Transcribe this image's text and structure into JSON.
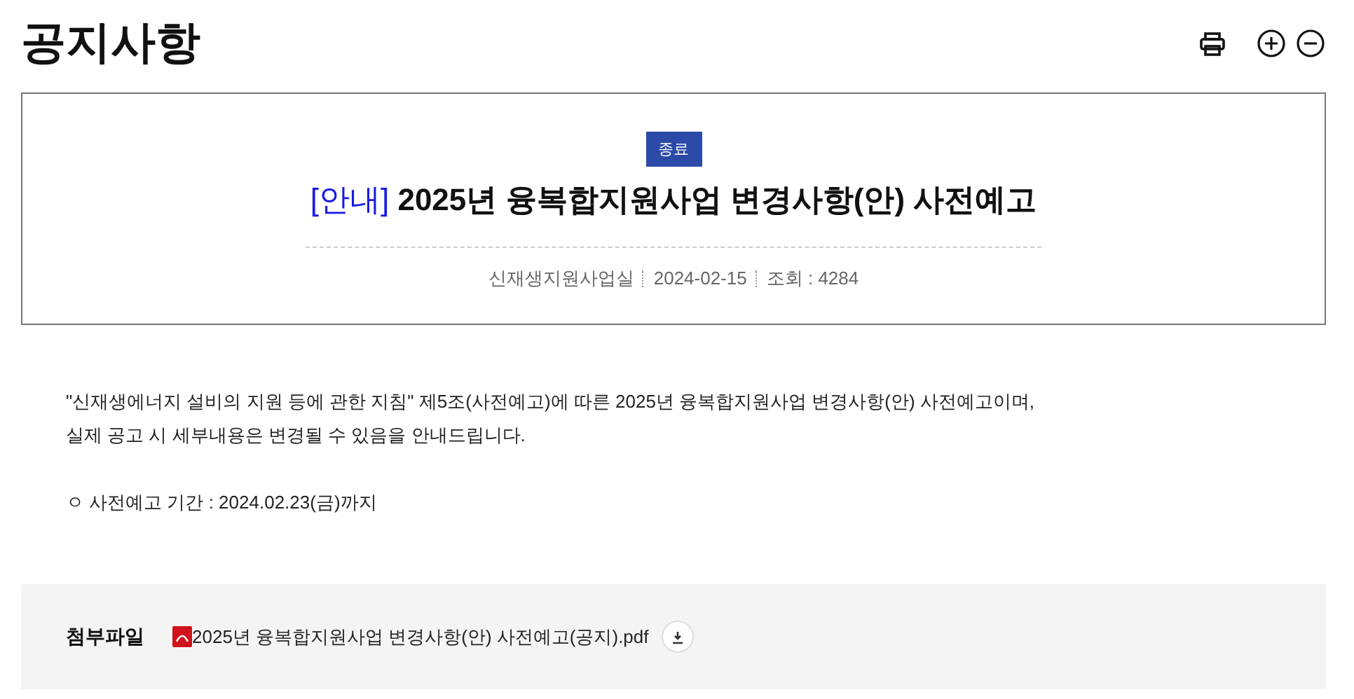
{
  "page_title": "공지사항",
  "toolbar": [
    {
      "kind": "print"
    },
    {
      "kind": "zoom_in"
    },
    {
      "kind": "zoom_out"
    }
  ],
  "notice": {
    "status": "종료",
    "category": "[안내]",
    "title": "2025년 융복합지원사업 변경사항(안) 사전예고",
    "meta": [
      {
        "text": "신재생지원사업실"
      },
      {
        "text": "2024-02-15"
      },
      {
        "text": "조회 : 4284"
      }
    ]
  },
  "body": [
    "\"신재생에너지 설비의 지원 등에 관한 지침\" 제5조(사전예고)에 따른 2025년 융복합지원사업 변경사항(안) 사전예고이며,",
    "실제 공고 시 세부내용은 변경될 수 있음을 안내드립니다."
  ],
  "period": "ㅇ 사전예고 기간 : 2024.02.23(금)까지",
  "attachments": {
    "label": "첨부파일",
    "files": [
      {
        "name": "2025년 융복합지원사업 변경사항(안) 사전예고(공지).pdf"
      }
    ]
  }
}
